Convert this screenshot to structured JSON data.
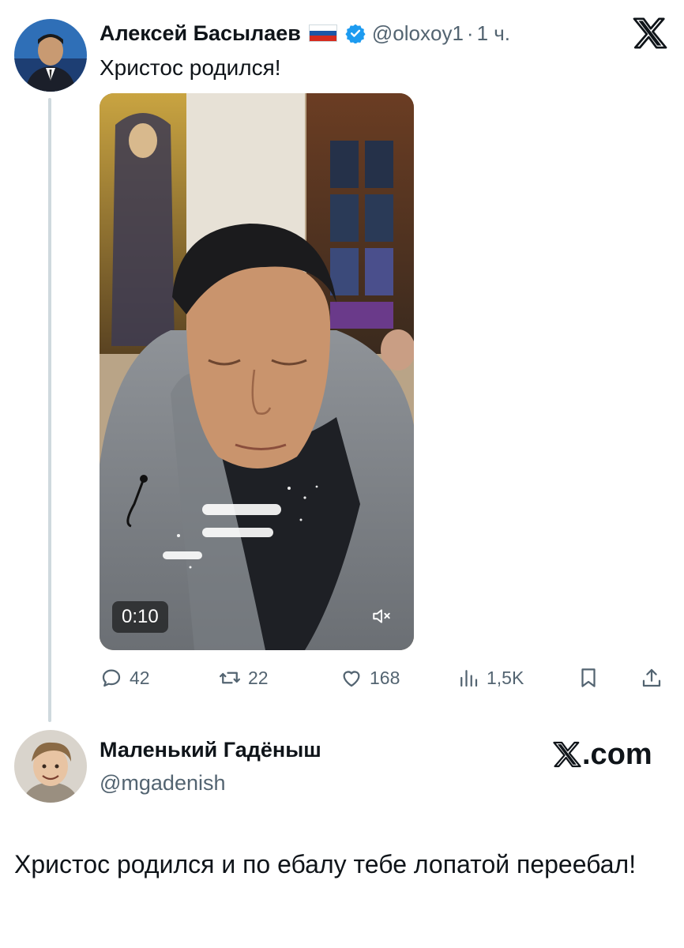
{
  "tweet": {
    "author_name": "Алексей Басылаев",
    "handle": "@oloxoy1",
    "separator": "·",
    "time": "1 ч.",
    "text": "Христос родился!",
    "video": {
      "duration": "0:10"
    },
    "stats": {
      "replies": "42",
      "retweets": "22",
      "likes": "168",
      "views": "1,5K"
    },
    "flag_colors": [
      "#ffffff",
      "#1c57a7",
      "#d52b1e"
    ],
    "verified_color": "#1d9bf0"
  },
  "reply": {
    "author_name": "Маленький Гадёныш",
    "handle": "@mgadenish",
    "text": "Христос родился и по ебалу тебе лопатой переебал!"
  },
  "watermark": {
    "suffix": ".com"
  },
  "icons": [
    "x-logo-icon",
    "verified-badge-icon",
    "reply-icon",
    "retweet-icon",
    "like-icon",
    "views-icon",
    "bookmark-icon",
    "share-icon",
    "mute-icon"
  ]
}
